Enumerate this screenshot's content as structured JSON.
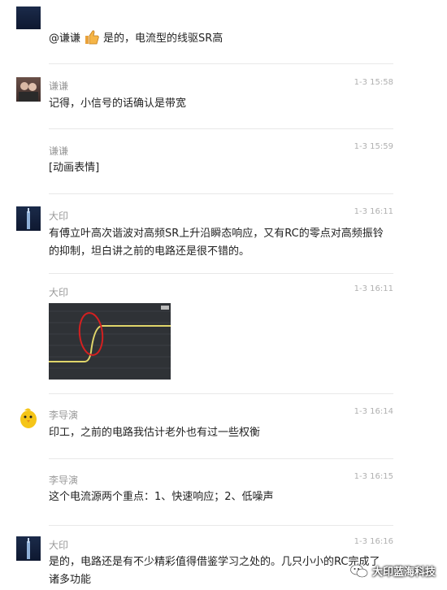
{
  "messages": [
    {
      "name": "",
      "time": "",
      "text_prefix": "@谦谦",
      "text": "是的，电流型的线驱SR高"
    },
    {
      "name": "谦谦",
      "time": "1-3 15:58",
      "text": "记得，小信号的话确认是带宽"
    },
    {
      "name": "谦谦",
      "time": "1-3 15:59",
      "text": "[动画表情]"
    },
    {
      "name": "大印",
      "time": "1-3 16:11",
      "text": "有傅立叶高次谐波对高频SR上升沿瞬态响应，又有RC的零点对高频振铃的抑制，坦白讲之前的电路还是很不错的。"
    },
    {
      "name": "大印",
      "time": "1-3 16:11",
      "text": ""
    },
    {
      "name": "李导演",
      "time": "1-3 16:14",
      "text": "印工，之前的电路我估计老外也有过一些权衡"
    },
    {
      "name": "李导演",
      "time": "1-3 16:15",
      "text": "这个电流源两个重点：1、快速响应；2、低噪声"
    },
    {
      "name": "大印",
      "time": "1-3 16:16",
      "text": "是的，电路还是有不少精彩值得借鉴学习之处的。几只小小的RC完成了诸多功能"
    }
  ],
  "watermark": {
    "text": "大印蓝海科技",
    "icon": "wechat-icon"
  },
  "colors": {
    "accent": "#d4c84a",
    "annotation": "#d42020"
  }
}
